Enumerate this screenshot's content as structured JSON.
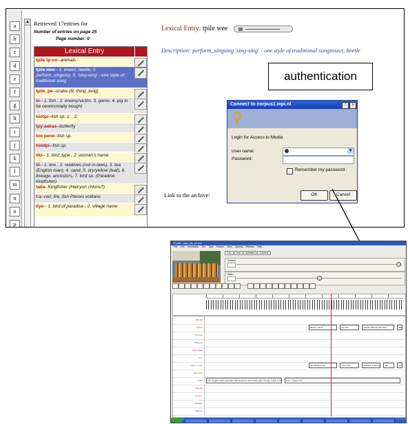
{
  "top_window": {
    "alphabet": [
      "a",
      "b",
      "c",
      "d",
      "e",
      "f",
      "g",
      "h",
      "i",
      "j",
      "k",
      "l",
      "m",
      "n",
      "o",
      "p"
    ],
    "retrieved_text": "Retrieved 17entries for",
    "entries_count": "Number of entries on page 25",
    "page_number": "Page number: 0",
    "table_header": "Lexical Entry",
    "entries": [
      {
        "head": "tpile tp:oo",
        "gloss": "--animals"
      },
      {
        "head": "tpile wee",
        "gloss": "-- 1. insect, beetle, 2. perform_singsing, 3. 'sing-sing' - one style of traditional song",
        "selected": true
      },
      {
        "head": "tpile_pe",
        "gloss": "--snake (lit. thing_long)"
      },
      {
        "head": "te",
        "gloss": "-- 1. fish , 2. enemy/victim, 3. game, 4. pig to be ceremonially bought"
      },
      {
        "head": "tóótpi",
        "gloss": "--fish sp. 1. , 2."
      },
      {
        "head": "tpy:aakaa",
        "gloss": "--butterfly"
      },
      {
        "head": "too pene",
        "gloss": "--fish sp."
      },
      {
        "head": "tóódpi",
        "gloss": "--fish sp."
      },
      {
        "head": "tiki",
        "gloss": "-- 1. bird_type , 2. woman's name"
      },
      {
        "head": "tii",
        "gloss": "-- 1. line , 2. relatives (not in-laws), 3. tea (English loan), 4. sand, 5. dry/yellow (leaf), 6. lineage, ancestors, 7. bird sp. (Paradise kingfisher)"
      },
      {
        "head": "tada",
        "gloss": "- Kingfisher (Halcyon chloris?)"
      },
      {
        "head": "t:a",
        "gloss": "--red_fire_fish Pterois volitans"
      },
      {
        "head": "tiye",
        "gloss": "-- 1. bird of paradise , 2. village name"
      }
    ],
    "lexical_entry_label": "Lexical Entry:",
    "lexical_entry_value": "tpile wee",
    "description": "Description: perform_singsing 'sing-sing' - one style of traditional songinsect, beetle",
    "auth_label": "authentication",
    "link_label": "Link to the archive:"
  },
  "dialog": {
    "title": "Connect to corpus1.mpi.nl",
    "title_buttons": [
      "?",
      "x"
    ],
    "login_text": "Login for Access to Media",
    "user_label": "User name:",
    "password_label": "Password:",
    "remember_label": "Remember my password",
    "ok_label": "OK",
    "cancel_label": "Cancel"
  },
  "elan": {
    "title": "ELAN - mpi_sik_s1.eaf",
    "menu": [
      "File",
      "Edit",
      "Annotation",
      "Tier",
      "Type",
      "Search",
      "View",
      "Options",
      "Window",
      "Help"
    ],
    "tabs": [
      "Grid",
      "Text",
      "Subtitles",
      "Controls"
    ],
    "volume_label": "Volume:",
    "rate_label": "Rate:",
    "volume_level_pct": 98,
    "rate_level_pct": 50,
    "tiers": [
      {
        "name": "Wendi1",
        "color": "#c03030",
        "anns": []
      },
      {
        "name": "Sensi1",
        "color": "#c03030",
        "anns": [
          [
            "Mtwei1 mama",
            0.52
          ],
          [
            "kin sam",
            0.68
          ],
          [
            "sarkwei Wend1 pam=Pen",
            0.79
          ],
          [
            "Mwlan",
            0.97
          ]
        ]
      },
      {
        "name": "Translati",
        "color": "#30a030",
        "anns": []
      },
      {
        "name": "Wegema",
        "color": "#3050c0",
        "anns": []
      },
      {
        "name": "Jaime Wale",
        "color": "#a030a0",
        "anns": []
      },
      {
        "name": "Tiber",
        "color": "#30a0a0",
        "anns": []
      },
      {
        "name": "Palmer Linde",
        "color": "#a07020",
        "anns": [
          [
            "Wendtingiri a pa",
            0.52
          ],
          [
            "Cha rs we",
            0.68
          ],
          [
            "mi iltavre li pam ngile oba",
            0.79
          ],
          [
            "Jen",
            0.9
          ],
          [
            "Wele",
            0.97
          ]
        ]
      },
      {
        "name": "Interveline",
        "color": "#30a030",
        "anns": []
      },
      {
        "name": "Tenet",
        "color": "#3050c0",
        "anns": [
          [
            "The singsinc about pig feast: Wendi and he wrote Wele gave the pig, if asin in the one eating it",
            0.0
          ],
          [
            "Fion, if wape Anm",
            0.4
          ]
        ]
      },
      {
        "name": "Wendi2",
        "color": "#c03030",
        "anns": []
      },
      {
        "name": "Ftanki k",
        "color": "#a07020",
        "anns": []
      },
      {
        "name": "Wetile k",
        "color": "#3050c0",
        "anns": []
      },
      {
        "name": "Wahei k",
        "color": "#3050c0",
        "anns": []
      }
    ]
  }
}
